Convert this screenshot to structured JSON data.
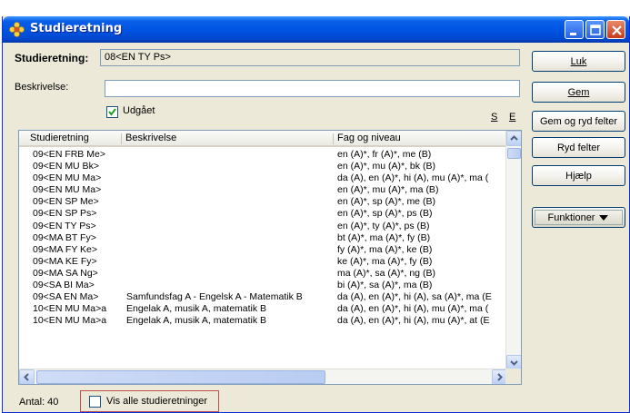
{
  "window": {
    "title": "Studieretning"
  },
  "form": {
    "studieretning_label": "Studieretning:",
    "studieretning_value": "08<EN TY Ps>",
    "beskrivelse_label": "Beskrivelse:",
    "beskrivelse_value": "",
    "udgaaet_label": "Udgået",
    "udgaaet_checked": true,
    "link_s": "S",
    "link_e": "E"
  },
  "buttons": {
    "luk": "Luk",
    "gem": "Gem",
    "gem_ryd": "Gem og ryd felter",
    "ryd": "Ryd felter",
    "hjaelp": "Hjælp",
    "funktioner": "Funktioner"
  },
  "grid": {
    "columns": [
      "Studieretning",
      "Beskrivelse",
      "Fag og niveau"
    ],
    "rows": [
      [
        "09<EN FRB Me>",
        "",
        "en (A)*, fr (A)*, me (B)"
      ],
      [
        "09<EN MU Bk>",
        "",
        "en (A)*, mu (A)*, bk (B)"
      ],
      [
        "09<EN MU Ma>",
        "",
        "da (A), en (A)*, hi (A), mu (A)*, ma ("
      ],
      [
        "09<EN MU Ma>",
        "",
        "en (A)*, mu (A)*, ma (B)"
      ],
      [
        "09<EN SP Me>",
        "",
        "en (A)*, sp (A)*, me (B)"
      ],
      [
        "09<EN SP Ps>",
        "",
        "en (A)*, sp (A)*, ps (B)"
      ],
      [
        "09<EN TY Ps>",
        "",
        "en (A)*, ty (A)*, ps (B)"
      ],
      [
        "09<MA BT Fy>",
        "",
        "bt (A)*, ma (A)*, fy (B)"
      ],
      [
        "09<MA FY Ke>",
        "",
        "fy (A)*, ma (A)*, ke (B)"
      ],
      [
        "09<MA KE Fy>",
        "",
        "ke (A)*, ma (A)*, fy (B)"
      ],
      [
        "09<MA SA Ng>",
        "",
        "ma (A)*, sa (A)*, ng (B)"
      ],
      [
        "09<SA BI Ma>",
        "",
        "bi (A)*, sa (A)*, ma (B)"
      ],
      [
        "09<SA EN Ma>",
        "Samfundsfag A - Engelsk A - Matematik B",
        "da (A), en (A)*, hi (A), sa (A)*, ma (E"
      ],
      [
        "10<EN MU Ma>a",
        "Engelak A, musik A, matematik B",
        "da (A), en (A)*, hi (A), mu (A)*, ma ("
      ],
      [
        "10<EN MU Ma>a",
        "Engelak A, musik A, matematik B",
        "da (A), en (A)*, hi (A), mu (A)*, at (E"
      ]
    ]
  },
  "status": {
    "count": "Antal: 40",
    "show_all_label": "Vis alle studieretninger",
    "show_all_checked": false
  }
}
